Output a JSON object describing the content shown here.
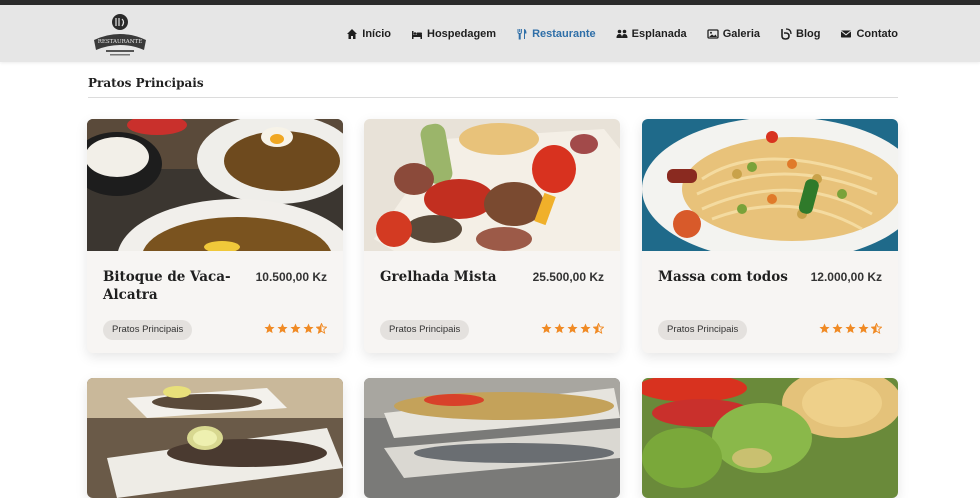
{
  "nav": {
    "items": [
      {
        "label": "Início",
        "icon": "home-icon",
        "active": false
      },
      {
        "label": "Hospedagem",
        "icon": "bed-icon",
        "active": false
      },
      {
        "label": "Restaurante",
        "icon": "utensils-icon",
        "active": true
      },
      {
        "label": "Esplanada",
        "icon": "people-icon",
        "active": false
      },
      {
        "label": "Galeria",
        "icon": "images-icon",
        "active": false
      },
      {
        "label": "Blog",
        "icon": "blog-icon",
        "active": false
      },
      {
        "label": "Contato",
        "icon": "envelope-icon",
        "active": false
      }
    ],
    "active_color": "#2f6fa8"
  },
  "logo": {
    "text": "RESTAURANTE"
  },
  "section": {
    "title": "Pratos Principais"
  },
  "cards": [
    {
      "name": "Bitoque de Vaca-Alcatra",
      "price": "10.500,00 Kz",
      "category": "Pratos Principais",
      "rating": 4.5
    },
    {
      "name": "Grelhada Mista",
      "price": "25.500,00 Kz",
      "category": "Pratos Principais",
      "rating": 4.5
    },
    {
      "name": "Massa com todos",
      "price": "12.000,00 Kz",
      "category": "Pratos Principais",
      "rating": 4.5
    }
  ],
  "colors": {
    "star": "#f08a24",
    "header_bg": "#e6e6e6",
    "card_bg": "#f7f5f3"
  }
}
